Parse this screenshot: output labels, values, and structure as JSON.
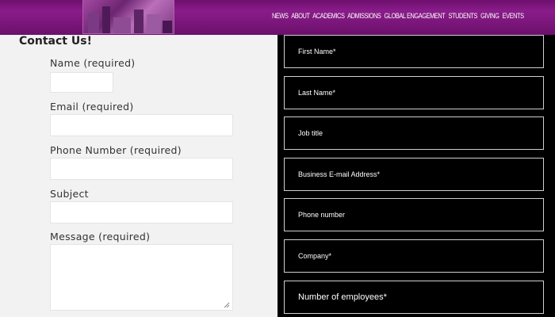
{
  "header": {
    "nav_items": [
      "NEWS",
      "ABOUT",
      "ACADEMICS",
      "ADMISSIONS",
      "GLOBAL ENGAGEMENT",
      "STUDENTS",
      "GIVING",
      "EVENTS"
    ]
  },
  "contact_form": {
    "title": "Contact Us!",
    "name_label": "Name (required)",
    "email_label": "Email (required)",
    "phone_label": "Phone Number (required)",
    "subject_label": "Subject",
    "message_label": "Message (required)"
  },
  "business_form": {
    "fields": [
      "First Name*",
      "Last Name*",
      "Job title",
      "Business E-mail Address*",
      "Phone number",
      "Company*",
      "Number of employees*"
    ]
  },
  "colors": {
    "header_purple": "#7a157a",
    "left_panel": "#f2f2f2",
    "right_panel": "#000000"
  }
}
